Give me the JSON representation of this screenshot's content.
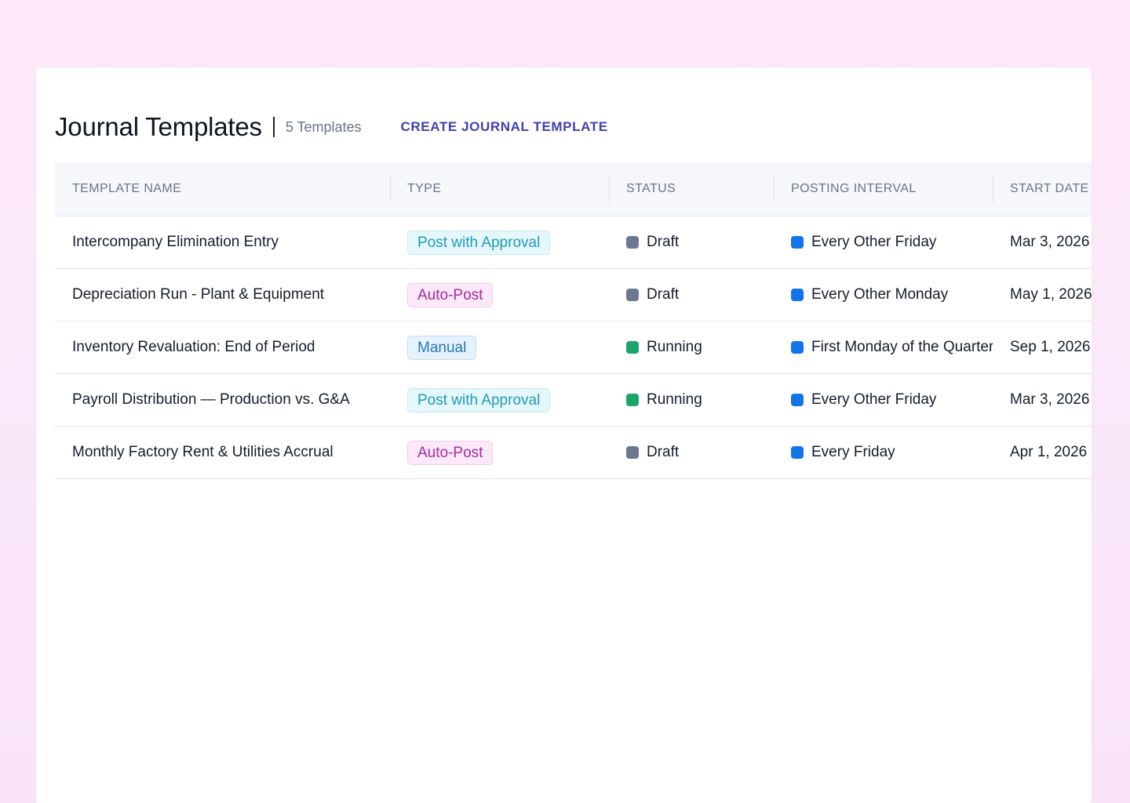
{
  "header": {
    "title": "Journal Templates",
    "count_label": "5 Templates",
    "create_label": "CREATE JOURNAL TEMPLATE"
  },
  "table": {
    "columns": [
      "TEMPLATE NAME",
      "TYPE",
      "STATUS",
      "POSTING INTERVAL",
      "START DATE"
    ],
    "rows": [
      {
        "name": "Intercompany Elimination Entry",
        "type": "Post with Approval",
        "type_kind": "approval",
        "status": "Draft",
        "status_kind": "draft",
        "interval": "Every Other Friday",
        "start": "Mar 3, 2026"
      },
      {
        "name": "Depreciation Run - Plant & Equipment",
        "type": "Auto-Post",
        "type_kind": "auto",
        "status": "Draft",
        "status_kind": "draft",
        "interval": "Every Other Monday",
        "start": "May 1, 2026"
      },
      {
        "name": "Inventory Revaluation: End of Period",
        "type": "Manual",
        "type_kind": "manual",
        "status": "Running",
        "status_kind": "running",
        "interval": "First Monday of the Quarter",
        "start": "Sep 1, 2026"
      },
      {
        "name": "Payroll Distribution — Production vs. G&A",
        "type": "Post with Approval",
        "type_kind": "approval",
        "status": "Running",
        "status_kind": "running",
        "interval": "Every Other Friday",
        "start": "Mar 3, 2026"
      },
      {
        "name": "Monthly Factory Rent & Utilities Accrual",
        "type": "Auto-Post",
        "type_kind": "auto",
        "status": "Draft",
        "status_kind": "draft",
        "interval": "Every Friday",
        "start": "Apr 1, 2026"
      }
    ]
  },
  "colors": {
    "accent": "#3f3fb8",
    "draft": "#6c7791",
    "running": "#1aa56a",
    "interval": "#1273ea",
    "approval_text": "#1f9bb9",
    "auto_text": "#a92aa0",
    "manual_text": "#2578b8"
  }
}
